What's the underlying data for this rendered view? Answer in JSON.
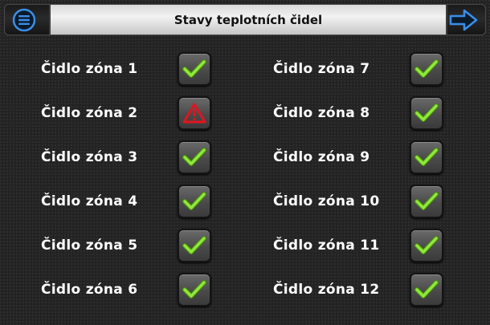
{
  "header": {
    "title": "Stavy teplotních čidel",
    "menu_icon": "menu-circle-icon",
    "next_icon": "arrow-right-icon"
  },
  "sensors": [
    {
      "label": "Čidlo zóna 1",
      "status": "ok"
    },
    {
      "label": "Čidlo zóna 2",
      "status": "error"
    },
    {
      "label": "Čidlo zóna 3",
      "status": "ok"
    },
    {
      "label": "Čidlo zóna 4",
      "status": "ok"
    },
    {
      "label": "Čidlo zóna 5",
      "status": "ok"
    },
    {
      "label": "Čidlo zóna 6",
      "status": "ok"
    },
    {
      "label": "Čidlo zóna 7",
      "status": "ok"
    },
    {
      "label": "Čidlo zóna 8",
      "status": "ok"
    },
    {
      "label": "Čidlo zóna 9",
      "status": "ok"
    },
    {
      "label": "Čidlo zóna 10",
      "status": "ok"
    },
    {
      "label": "Čidlo zóna 11",
      "status": "ok"
    },
    {
      "label": "Čidlo zóna 12",
      "status": "ok"
    }
  ],
  "colors": {
    "ok": "#7ed321",
    "error": "#e0141e",
    "accent": "#3a8ee8"
  }
}
